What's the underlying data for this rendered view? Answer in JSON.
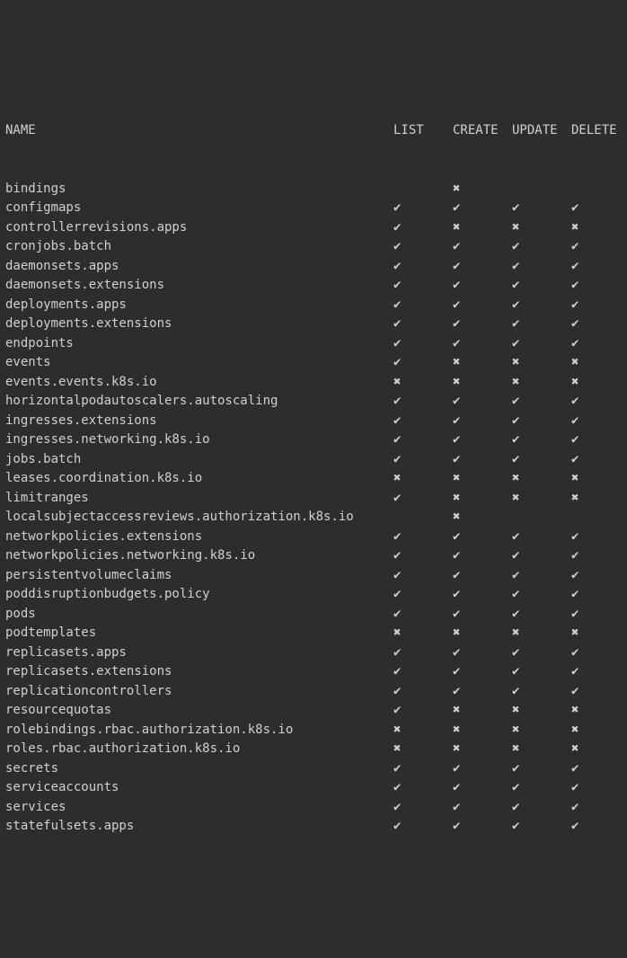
{
  "icons": {
    "check": "✔",
    "cross": "✖"
  },
  "headers": {
    "name": "NAME",
    "list": "LIST",
    "create": "CREATE",
    "update": "UPDATE",
    "delete": "DELETE"
  },
  "rows": [
    {
      "name": "bindings",
      "list": "",
      "create": "cross",
      "update": "",
      "delete": ""
    },
    {
      "name": "configmaps",
      "list": "check",
      "create": "check",
      "update": "check",
      "delete": "check"
    },
    {
      "name": "controllerrevisions.apps",
      "list": "check",
      "create": "cross",
      "update": "cross",
      "delete": "cross"
    },
    {
      "name": "cronjobs.batch",
      "list": "check",
      "create": "check",
      "update": "check",
      "delete": "check"
    },
    {
      "name": "daemonsets.apps",
      "list": "check",
      "create": "check",
      "update": "check",
      "delete": "check"
    },
    {
      "name": "daemonsets.extensions",
      "list": "check",
      "create": "check",
      "update": "check",
      "delete": "check"
    },
    {
      "name": "deployments.apps",
      "list": "check",
      "create": "check",
      "update": "check",
      "delete": "check"
    },
    {
      "name": "deployments.extensions",
      "list": "check",
      "create": "check",
      "update": "check",
      "delete": "check"
    },
    {
      "name": "endpoints",
      "list": "check",
      "create": "check",
      "update": "check",
      "delete": "check"
    },
    {
      "name": "events",
      "list": "check",
      "create": "cross",
      "update": "cross",
      "delete": "cross"
    },
    {
      "name": "events.events.k8s.io",
      "list": "cross",
      "create": "cross",
      "update": "cross",
      "delete": "cross"
    },
    {
      "name": "horizontalpodautoscalers.autoscaling",
      "list": "check",
      "create": "check",
      "update": "check",
      "delete": "check"
    },
    {
      "name": "ingresses.extensions",
      "list": "check",
      "create": "check",
      "update": "check",
      "delete": "check"
    },
    {
      "name": "ingresses.networking.k8s.io",
      "list": "check",
      "create": "check",
      "update": "check",
      "delete": "check"
    },
    {
      "name": "jobs.batch",
      "list": "check",
      "create": "check",
      "update": "check",
      "delete": "check"
    },
    {
      "name": "leases.coordination.k8s.io",
      "list": "cross",
      "create": "cross",
      "update": "cross",
      "delete": "cross"
    },
    {
      "name": "limitranges",
      "list": "check",
      "create": "cross",
      "update": "cross",
      "delete": "cross"
    },
    {
      "name": "localsubjectaccessreviews.authorization.k8s.io",
      "list": "",
      "create": "cross",
      "update": "",
      "delete": ""
    },
    {
      "name": "networkpolicies.extensions",
      "list": "check",
      "create": "check",
      "update": "check",
      "delete": "check"
    },
    {
      "name": "networkpolicies.networking.k8s.io",
      "list": "check",
      "create": "check",
      "update": "check",
      "delete": "check"
    },
    {
      "name": "persistentvolumeclaims",
      "list": "check",
      "create": "check",
      "update": "check",
      "delete": "check"
    },
    {
      "name": "poddisruptionbudgets.policy",
      "list": "check",
      "create": "check",
      "update": "check",
      "delete": "check"
    },
    {
      "name": "pods",
      "list": "check",
      "create": "check",
      "update": "check",
      "delete": "check"
    },
    {
      "name": "podtemplates",
      "list": "cross",
      "create": "cross",
      "update": "cross",
      "delete": "cross"
    },
    {
      "name": "replicasets.apps",
      "list": "check",
      "create": "check",
      "update": "check",
      "delete": "check"
    },
    {
      "name": "replicasets.extensions",
      "list": "check",
      "create": "check",
      "update": "check",
      "delete": "check"
    },
    {
      "name": "replicationcontrollers",
      "list": "check",
      "create": "check",
      "update": "check",
      "delete": "check"
    },
    {
      "name": "resourcequotas",
      "list": "check",
      "create": "cross",
      "update": "cross",
      "delete": "cross"
    },
    {
      "name": "rolebindings.rbac.authorization.k8s.io",
      "list": "cross",
      "create": "cross",
      "update": "cross",
      "delete": "cross"
    },
    {
      "name": "roles.rbac.authorization.k8s.io",
      "list": "cross",
      "create": "cross",
      "update": "cross",
      "delete": "cross"
    },
    {
      "name": "secrets",
      "list": "check",
      "create": "check",
      "update": "check",
      "delete": "check"
    },
    {
      "name": "serviceaccounts",
      "list": "check",
      "create": "check",
      "update": "check",
      "delete": "check"
    },
    {
      "name": "services",
      "list": "check",
      "create": "check",
      "update": "check",
      "delete": "check"
    },
    {
      "name": "statefulsets.apps",
      "list": "check",
      "create": "check",
      "update": "check",
      "delete": "check"
    }
  ]
}
